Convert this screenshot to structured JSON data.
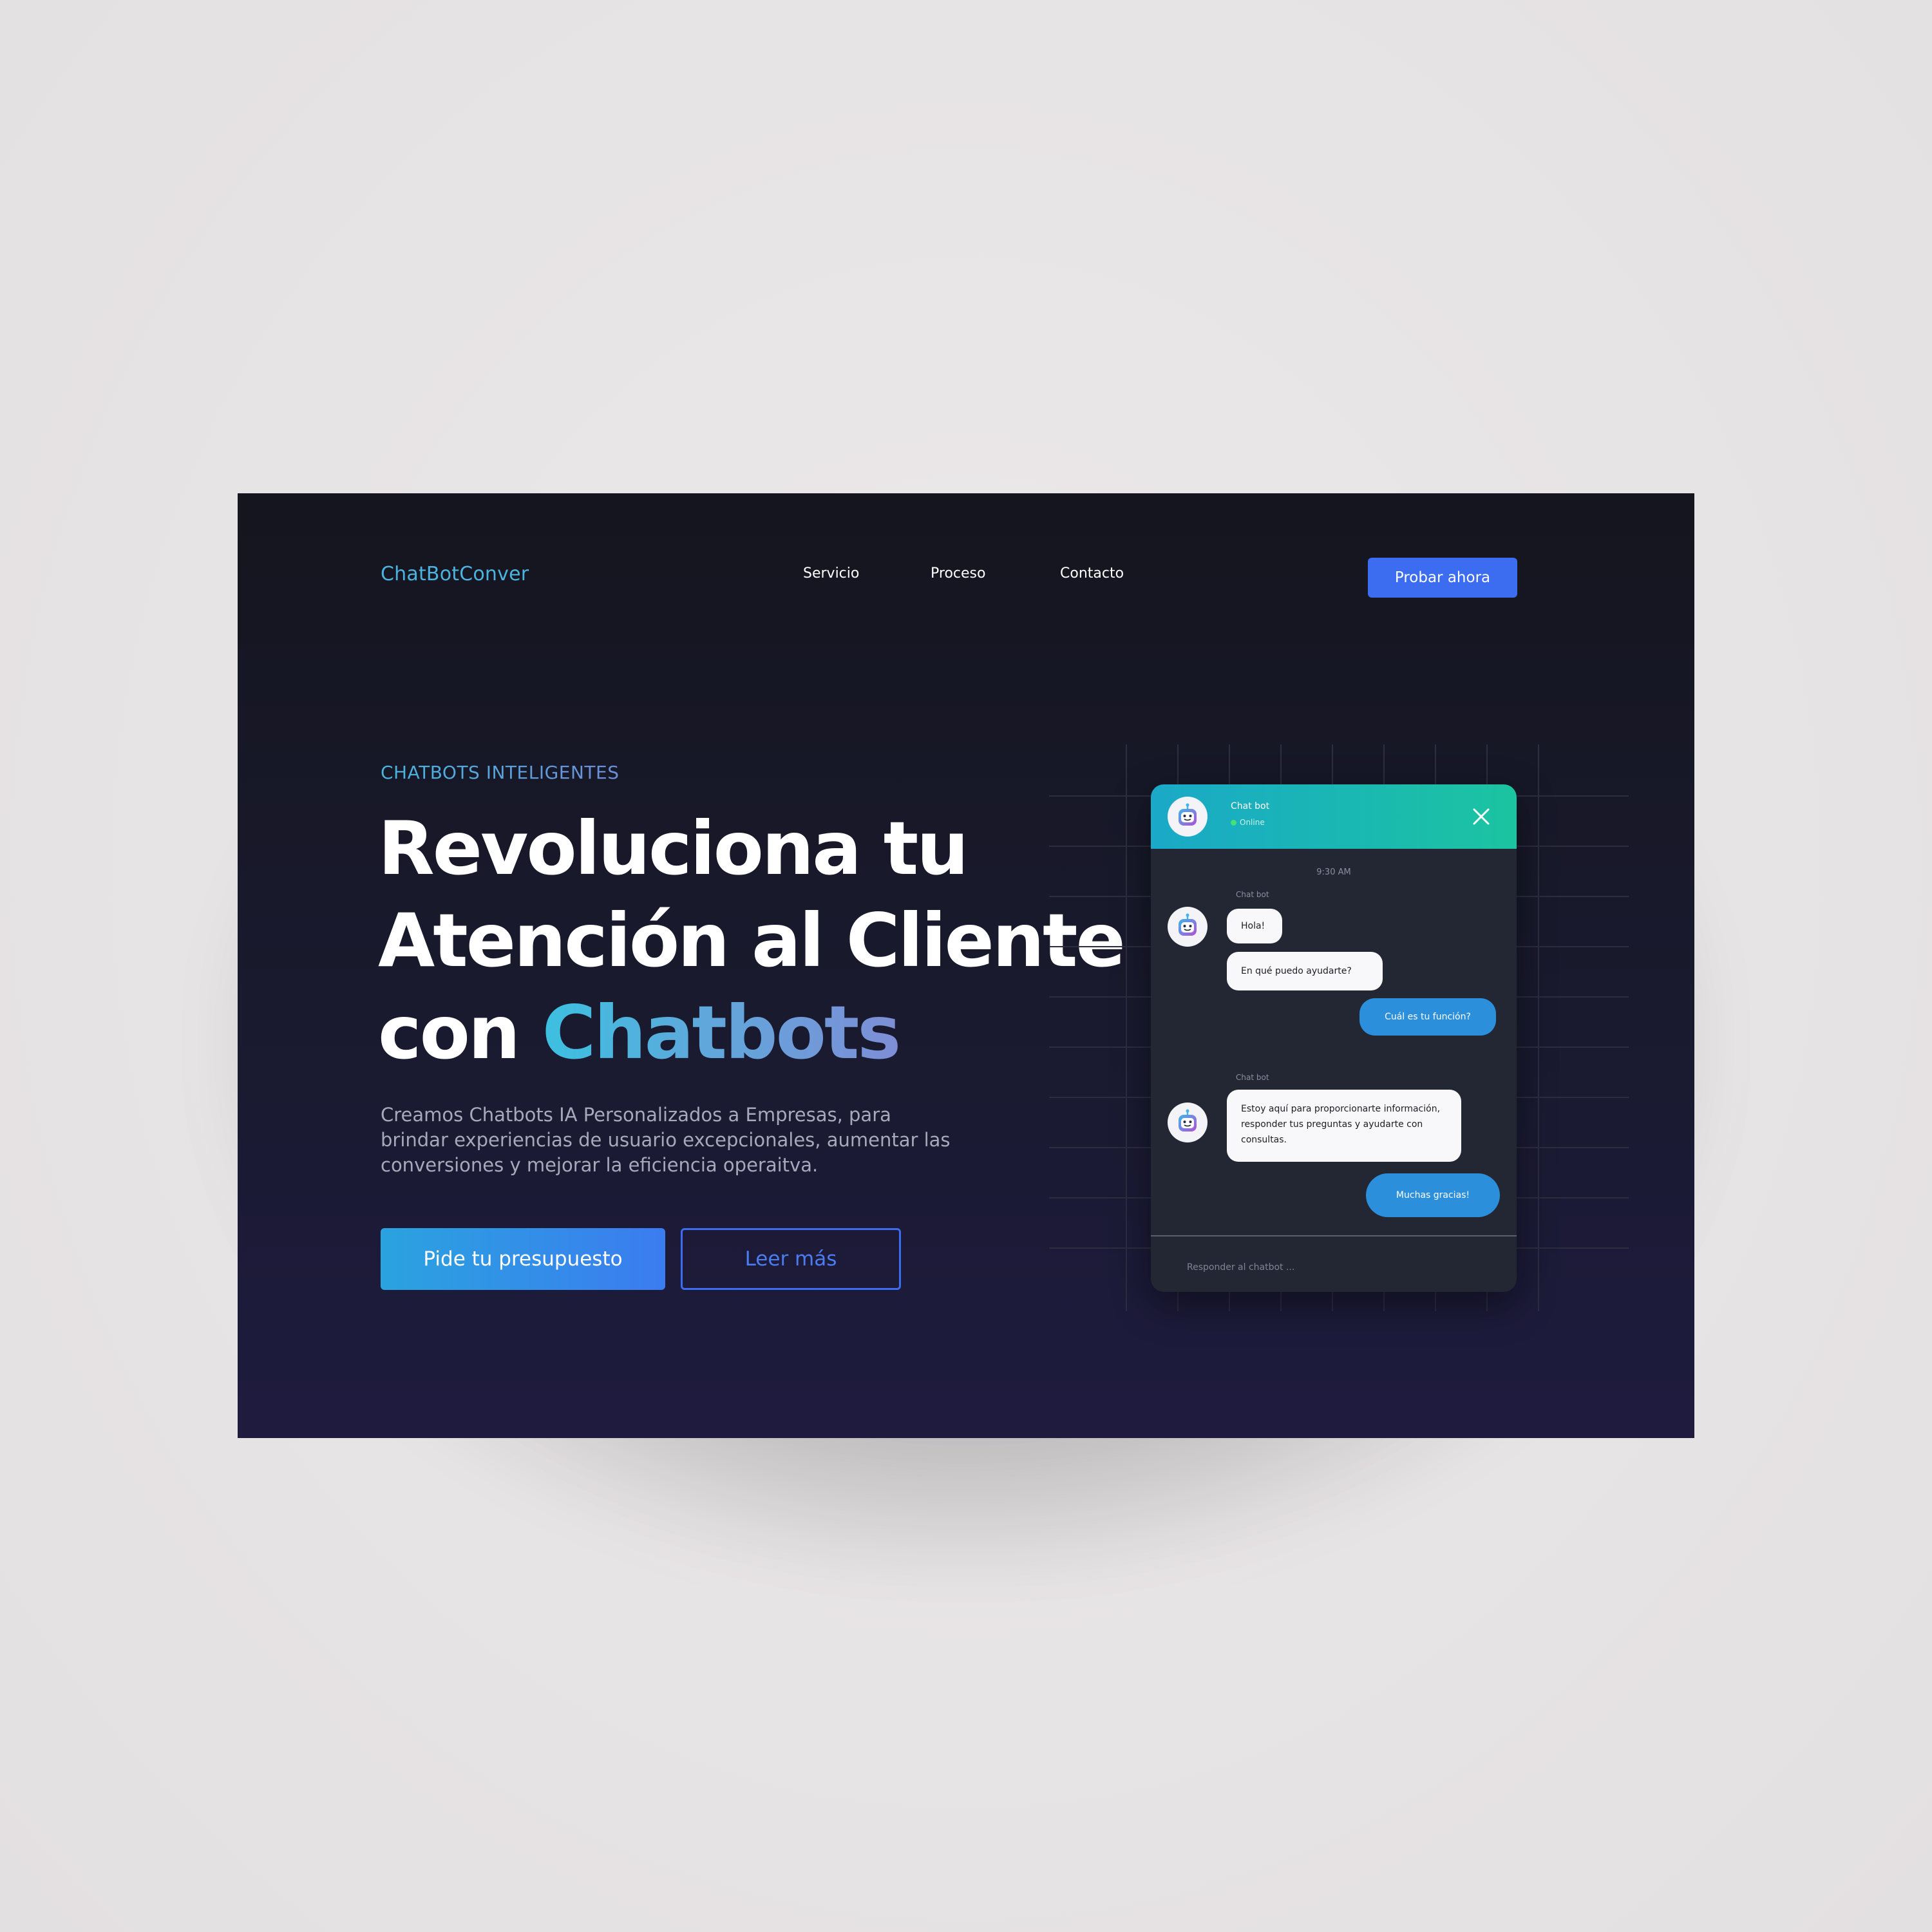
{
  "brand": "ChatBotConver",
  "nav": {
    "items": [
      "Servicio",
      "Proceso",
      "Contacto"
    ],
    "cta": "Probar ahora"
  },
  "hero": {
    "eyebrow": "CHATBOTS INTELIGENTES",
    "headline": {
      "line1": "Revoluciona tu",
      "line2": "Atención al Cliente",
      "line3_plain": "con ",
      "line3_highlight": "Chatbots"
    },
    "lead": "Creamos Chatbots IA Personalizados a Empresas, para brindar experiencias de usuario excepcionales, aumentar las conversiones y mejorar la eficiencia operaitva.",
    "primary_button": "Pide tu presupuesto",
    "secondary_button": "Leer más"
  },
  "chat": {
    "title": "Chat bot",
    "status": "Online",
    "time": "9:30 AM",
    "sender_label": "Chat bot",
    "messages": {
      "bot1": "Hola!",
      "bot2": "En qué puedo ayudarte?",
      "user1": "Cuál es tu función?",
      "bot3": "Estoy aquí para proporcionarte información, responder tus preguntas y ayudarte con consultas.",
      "user2": "Muchas gracias!"
    },
    "reply_placeholder": "Responder al chatbot ..."
  },
  "colors": {
    "accent_blue": "#3c6cf0",
    "brand_cyan": "#4bb3e0",
    "header_gradient_start": "#1aa9c8",
    "header_gradient_end": "#1bc4a0",
    "user_bubble": "#2b8fdc",
    "online_dot": "#45e07a"
  },
  "icons": [
    "robot-avatar-icon",
    "close-icon",
    "online-dot-icon"
  ]
}
